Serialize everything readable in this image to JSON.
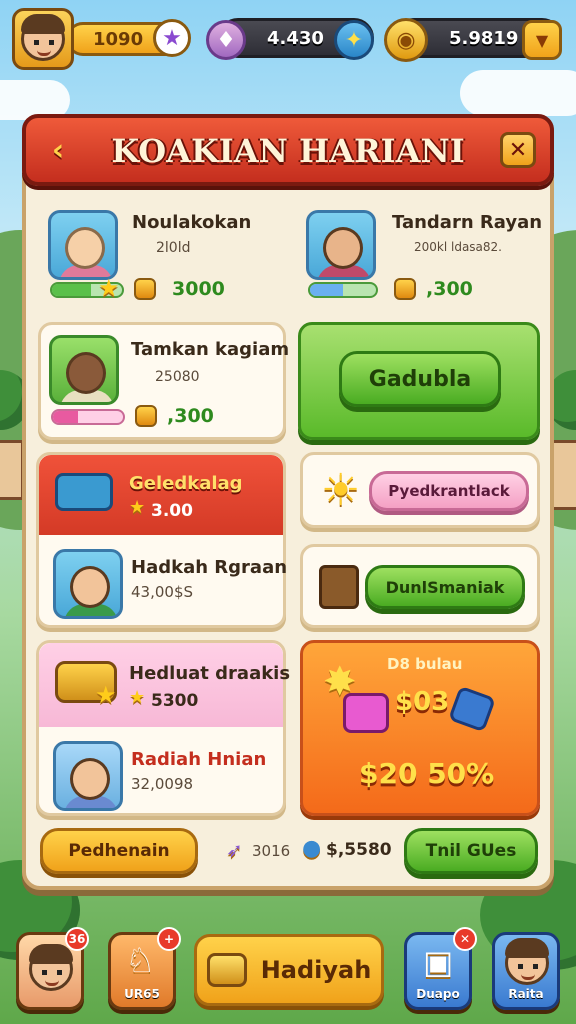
{
  "top_bar": {
    "level": "1090",
    "gems": "4.430",
    "coins": "5.9819"
  },
  "header": {
    "title": "KOAKIAN HARIANI"
  },
  "cards": {
    "c1": {
      "name": "Noulakokan",
      "sub": "2l0ld",
      "reward": "3000",
      "progress": 0.55
    },
    "c2": {
      "name": "Tandarn Rayan",
      "sub": "200kl ldasa82.",
      "reward": ",300",
      "progress": 0.5
    },
    "c3": {
      "name": "Tamkan kagiam",
      "sub": "25080",
      "reward": ",300",
      "progress": 0.35
    },
    "claim_button": "Gadubla",
    "c4": {
      "title": "Geledkalag",
      "value": "3.00"
    },
    "c5": {
      "name": "Hadkah Rgraan",
      "sub": "43,00$S"
    },
    "pink_button": "Pyedkrantlack",
    "green_button": "DunlSmaniak",
    "c6": {
      "title": "Hedluat draakis",
      "value": "5300"
    },
    "c7": {
      "name": "Radiah Hnian",
      "sub": "32,0098"
    },
    "promo": {
      "label": "D8 bulau",
      "price": "$03",
      "discount": "$20 50%"
    }
  },
  "footer_row": {
    "left_button": "Pedhenain",
    "stat1": "3016",
    "stat2": "$,5580",
    "right_button": "Tnil GUes"
  },
  "bottom_nav": {
    "b1_badge": "36",
    "b2_label": "UR65",
    "b2_badge": "+",
    "main_label": "Hadiyah",
    "b4_label": "Duapo",
    "b5_label": "Raita"
  }
}
